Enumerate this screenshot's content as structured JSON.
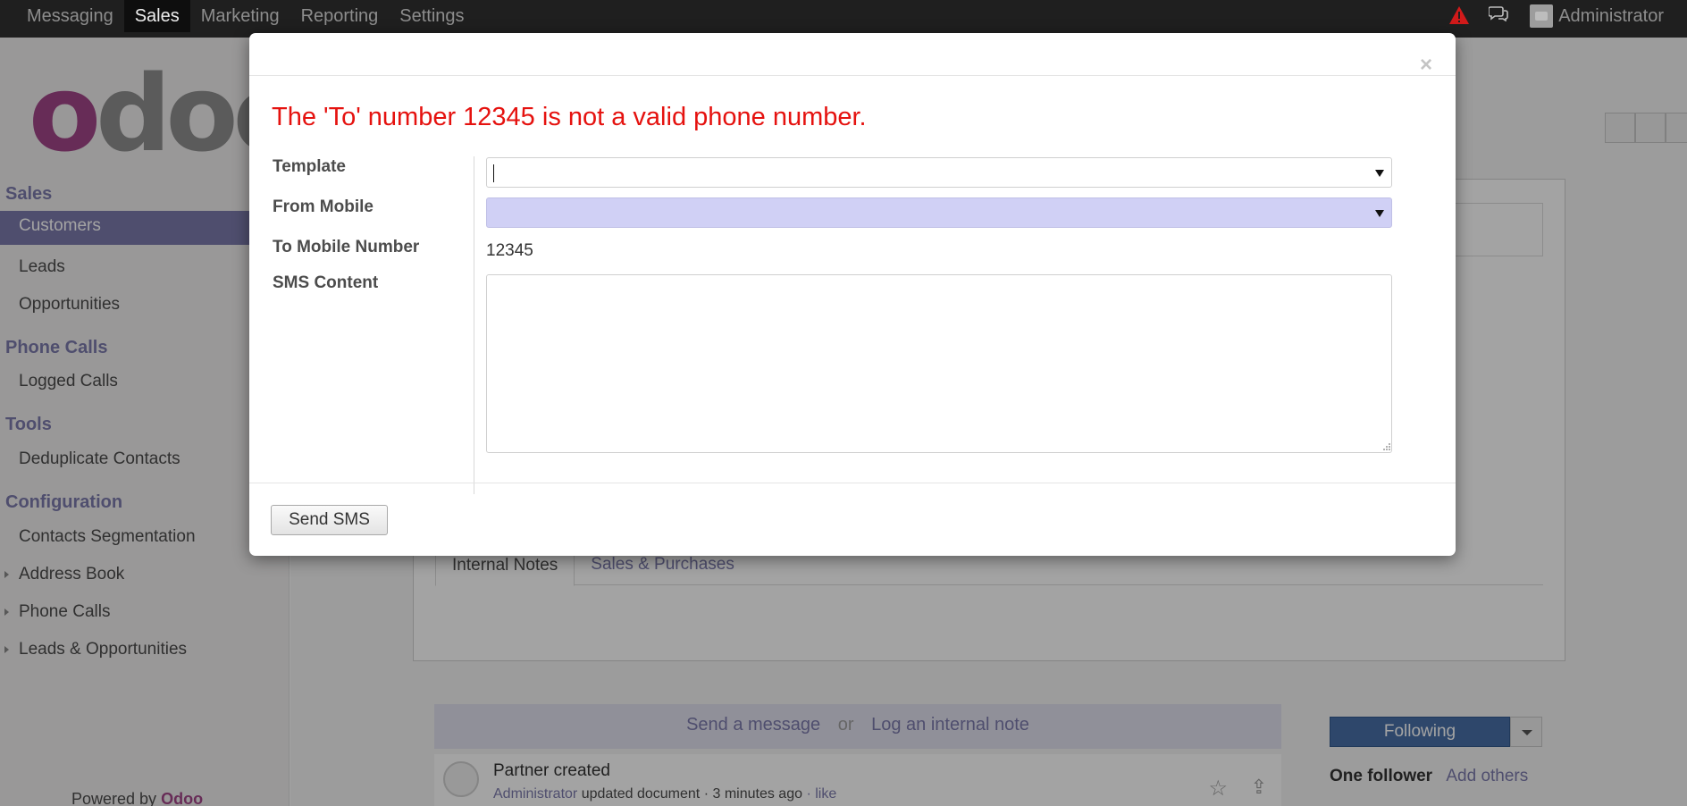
{
  "topbar": {
    "menu": [
      "Messaging",
      "Sales",
      "Marketing",
      "Reporting",
      "Settings"
    ],
    "active_index": 1,
    "user": "Administrator"
  },
  "sidebar": {
    "logo_text": "odoo",
    "sections": [
      {
        "title": "Sales",
        "items": [
          "Customers",
          "Leads",
          "Opportunities"
        ]
      },
      {
        "title": "Phone Calls",
        "items": [
          "Logged Calls"
        ]
      },
      {
        "title": "Tools",
        "items": [
          "Deduplicate Contacts"
        ]
      },
      {
        "title": "Configuration",
        "items": [
          "Contacts Segmentation",
          "Address Book",
          "Phone Calls",
          "Leads & Opportunities"
        ]
      }
    ],
    "active_item": "Customers",
    "powered_by_prefix": "Powered by",
    "powered_by_brand": "Odoo"
  },
  "form": {
    "tabs": [
      "Internal Notes",
      "Sales & Purchases"
    ]
  },
  "chatter": {
    "send_message": "Send a message",
    "or": "or",
    "log_note": "Log an internal note",
    "message_title": "Partner created",
    "message_author": "Administrator",
    "message_action": "updated document",
    "message_time": "3 minutes ago",
    "message_like": "like",
    "follow_label": "Following",
    "followers_count": "One follower",
    "add_followers": "Add others"
  },
  "modal": {
    "close": "×",
    "error": "The 'To' number 12345 is not a valid phone number.",
    "labels": {
      "template": "Template",
      "from_mobile": "From Mobile",
      "to_mobile": "To Mobile Number",
      "sms_content": "SMS Content"
    },
    "values": {
      "template": "",
      "from_mobile": "",
      "to_mobile": "12345",
      "sms_content": ""
    },
    "send_button": "Send SMS"
  },
  "colors": {
    "error": "#e5120f",
    "accent": "#7c7bad",
    "required_field": "#d0d0f5",
    "topbar": "#1f1f1f",
    "logo_brand": "#a24689"
  }
}
